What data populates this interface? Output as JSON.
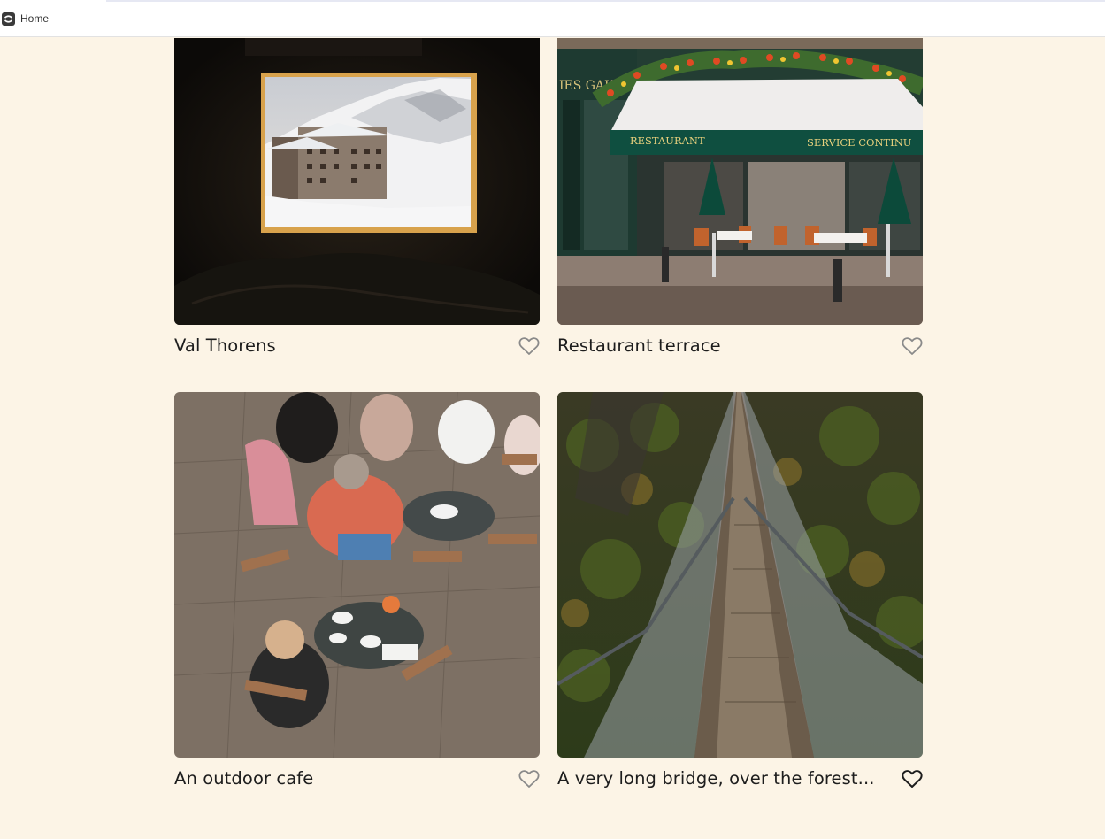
{
  "topbar": {
    "home_label": "Home"
  },
  "cards": [
    {
      "title": "Val Thorens",
      "favorited": false
    },
    {
      "title": "Restaurant terrace",
      "favorited": false
    },
    {
      "title": "An outdoor cafe",
      "favorited": false
    },
    {
      "title": "A very long bridge, over the forest...",
      "favorited": true
    }
  ],
  "restaurant_sign": {
    "shop_name": "IES GAUBERT",
    "left_text": "RESTAURANT",
    "right_text": "SERVICE CONTINU"
  },
  "colors": {
    "page_background": "#fcf4e6",
    "text": "#1d1d1d",
    "heart_outline_inactive": "#8a8a8a",
    "heart_outline_active": "#1d1d1d"
  }
}
